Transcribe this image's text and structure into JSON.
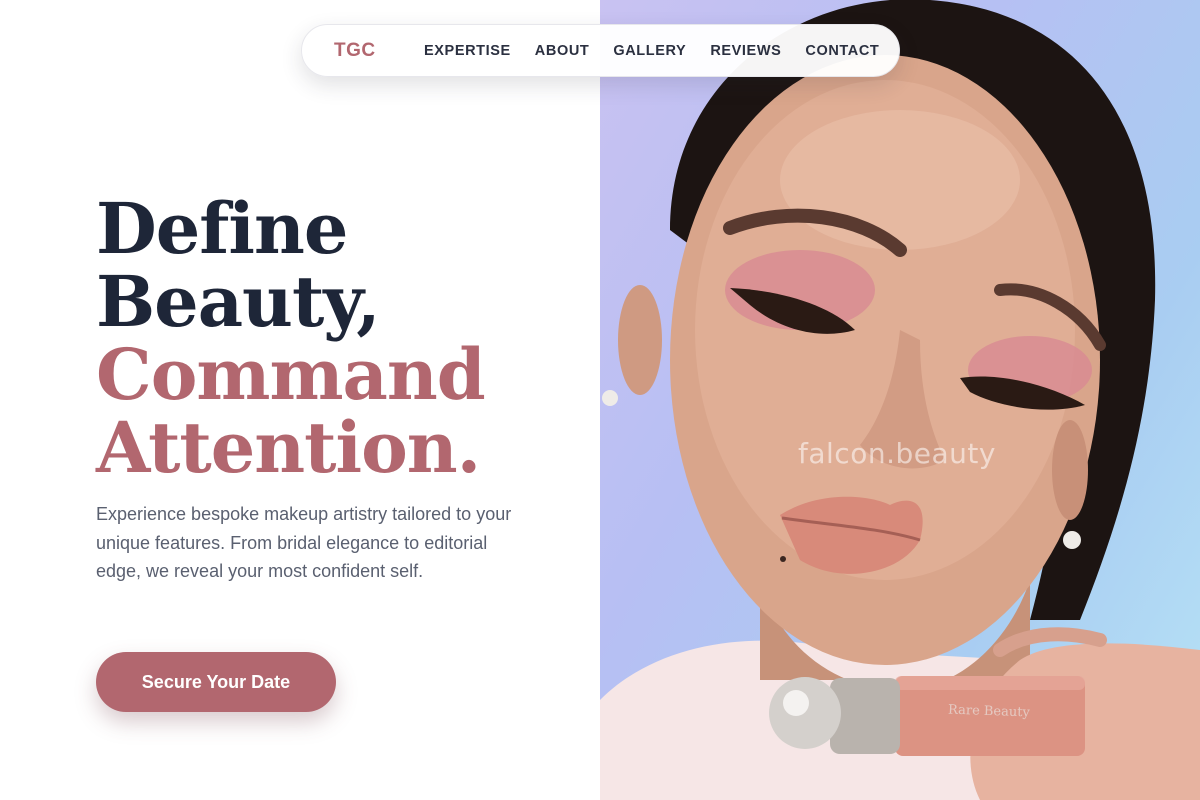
{
  "brand": {
    "logo": "TGC",
    "accent_color": "#b2676f",
    "dark_color": "#1e2638"
  },
  "nav": {
    "links": [
      "EXPERTISE",
      "ABOUT",
      "GALLERY",
      "REVIEWS",
      "CONTACT"
    ]
  },
  "hero": {
    "headline_line1": "Define",
    "headline_line2": "Beauty,",
    "headline_line3": "Command",
    "headline_line4": "Attention.",
    "lead": "Experience bespoke makeup artistry tailored to your unique features. From bridal elegance to editorial edge, we reveal your most confident self.",
    "cta_label": "Secure Your Date"
  },
  "photo": {
    "watermark": "falcon.beauty",
    "product_label": "Rare Beauty"
  }
}
